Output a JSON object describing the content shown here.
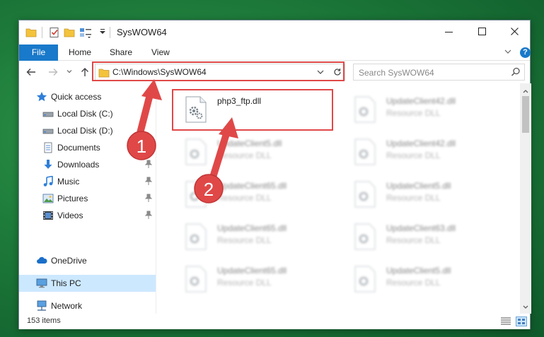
{
  "window": {
    "title": "SysWOW64"
  },
  "ribbon": {
    "tabs": [
      "File",
      "Home",
      "Share",
      "View"
    ],
    "help": "?"
  },
  "address": {
    "path": "C:\\Windows\\SysWOW64"
  },
  "search": {
    "placeholder": "Search SysWOW64"
  },
  "sidebar": {
    "items": [
      {
        "label": "Quick access",
        "icon": "star-icon"
      },
      {
        "label": "Local Disk (C:)",
        "icon": "drive-icon"
      },
      {
        "label": "Local Disk (D:)",
        "icon": "drive-icon"
      },
      {
        "label": "Documents",
        "icon": "documents-icon"
      },
      {
        "label": "Downloads",
        "icon": "download-icon"
      },
      {
        "label": "Music",
        "icon": "music-icon"
      },
      {
        "label": "Pictures",
        "icon": "pictures-icon"
      },
      {
        "label": "Videos",
        "icon": "videos-icon"
      },
      {
        "label": "OneDrive",
        "icon": "cloud-icon"
      },
      {
        "label": "This PC",
        "icon": "computer-icon"
      },
      {
        "label": "Network",
        "icon": "network-icon"
      }
    ]
  },
  "files": [
    {
      "name": "php3_ftp.dll",
      "type": ""
    },
    {
      "name": "UpdateClient42.dll",
      "type": "Resource DLL"
    },
    {
      "name": "UpdateClient5.dll",
      "type": "Resource DLL"
    },
    {
      "name": "UpdateClient42.dll",
      "type": "Resource DLL"
    },
    {
      "name": "UpdateClient65.dll",
      "type": "Resource DLL"
    },
    {
      "name": "UpdateClient5.dll",
      "type": "Resource DLL"
    },
    {
      "name": "UpdateClient65.dll",
      "type": "Resource DLL"
    },
    {
      "name": "UpdateClient63.dll",
      "type": "Resource DLL"
    },
    {
      "name": "UpdateClient65.dll",
      "type": "Resource DLL"
    },
    {
      "name": "UpdateClient5.dll",
      "type": "Resource DLL"
    }
  ],
  "status": {
    "item_count": "153 items"
  },
  "annotations": {
    "step1": "1",
    "step2": "2",
    "color": "#e04848"
  },
  "colors": {
    "accent": "#1979ca",
    "selection": "#cce8ff"
  }
}
